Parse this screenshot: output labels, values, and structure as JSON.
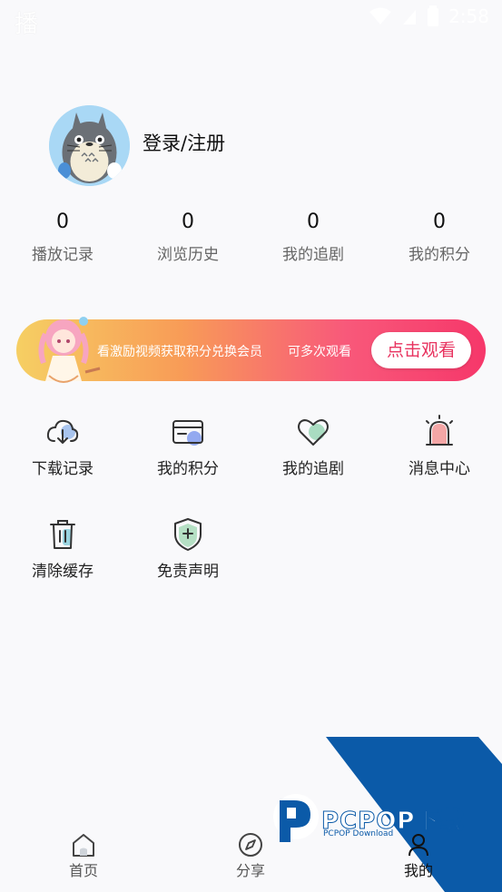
{
  "status_bar": {
    "app_icon": "播",
    "time": "2:58",
    "icons": [
      "wifi-icon",
      "signal-icon",
      "battery-icon"
    ]
  },
  "profile": {
    "login_label": "登录/注册",
    "avatar": "totoro-avatar"
  },
  "stats": [
    {
      "count": "0",
      "label": "播放记录"
    },
    {
      "count": "0",
      "label": "浏览历史"
    },
    {
      "count": "0",
      "label": "我的追剧"
    },
    {
      "count": "0",
      "label": "我的积分"
    }
  ],
  "promo": {
    "text": "看激励视频获取积分兑换会员",
    "sub_text": "可多次观看",
    "button": "点击观看"
  },
  "menu": [
    {
      "label": "下载记录",
      "icon": "cloud-download-icon"
    },
    {
      "label": "我的积分",
      "icon": "card-icon"
    },
    {
      "label": "我的追剧",
      "icon": "heart-icon"
    },
    {
      "label": "消息中心",
      "icon": "alarm-icon"
    },
    {
      "label": "清除缓存",
      "icon": "trash-icon"
    },
    {
      "label": "免责声明",
      "icon": "shield-plus-icon"
    }
  ],
  "watermark": {
    "brand": "PCPOP下载",
    "sub": "PCPOP Download"
  },
  "bottom_nav": [
    {
      "label": "首页",
      "icon": "home-icon"
    },
    {
      "label": "分享",
      "icon": "compass-icon"
    },
    {
      "label": "我的",
      "icon": "profile-icon"
    }
  ],
  "colors": {
    "accent": "#e8335f",
    "promo_start": "#f6cf63",
    "promo_end": "#f6376a",
    "icon_stroke": "#333333"
  }
}
